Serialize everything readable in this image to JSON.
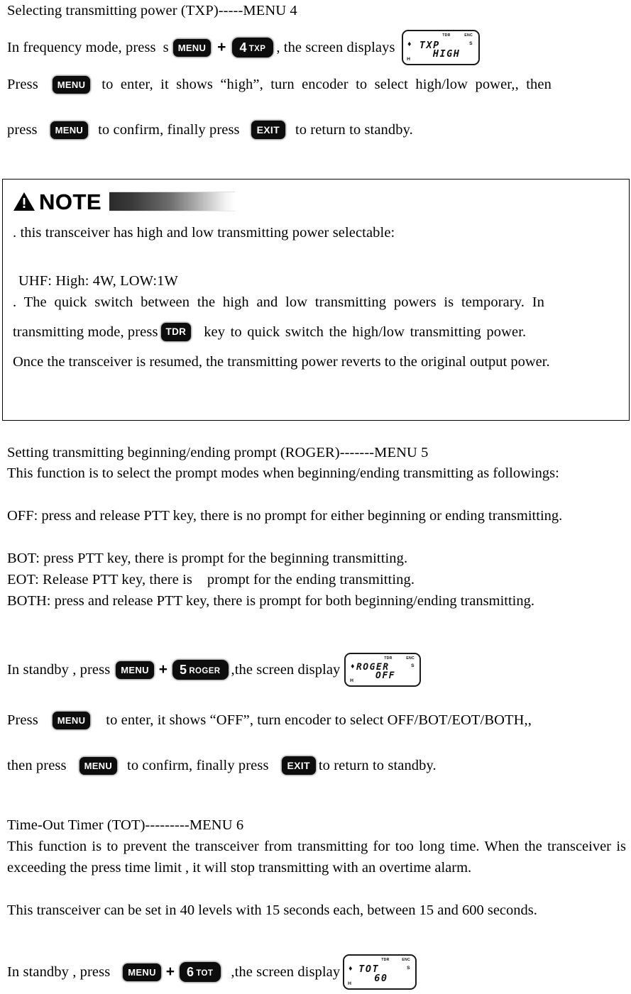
{
  "document": {
    "type": "two-way-radio-user-manual-page"
  },
  "section_txp": {
    "heading": "Selecting transmitting power (TXP)-----MENU 4",
    "line1_a": "In frequency mode, press",
    "line1_stray": "s",
    "line1_b": ", the screen displays",
    "keys": {
      "menu": "MENU",
      "num4_digit": "4",
      "num4_label": "TXP"
    },
    "lcd": {
      "line1": "TXP",
      "line2": "HIGH",
      "tiny_tdr": "TDR",
      "tiny_enc": "ENC",
      "tiny_s": "S",
      "tiny_h": "H",
      "tiny_dot": "♦"
    },
    "line2_a": "Press",
    "line2_b": "to enter, it shows “high”, turn encoder to select high/low power,, then",
    "line3_a": "press",
    "line3_b": "to confirm, finally press",
    "line3_c": "to return to standby.",
    "key_exit": "EXIT"
  },
  "note_box": {
    "title": "NOTE",
    "icon": "warning-triangle-icon",
    "bullet1": ". this transceiver has high and low transmitting power selectable:",
    "spec": "UHF: High: 4W, LOW:1W",
    "bullet2_a": ". The quick switch between the high and low transmitting powers is temporary. In",
    "bullet2_b": "transmitting mode, press",
    "key_tdr": "TDR",
    "bullet2_c": "key to quick switch the high/low transmitting power.",
    "bullet2_d": "Once the transceiver is resumed, the transmitting power reverts to the original output power."
  },
  "section_roger": {
    "heading": "Setting transmitting beginning/ending prompt (ROGER)-------MENU 5",
    "intro": "This function is to select the prompt modes when beginning/ending transmitting as followings:",
    "modes": [
      "OFF: press and release PTT key, there is no prompt for either beginning or ending transmitting.",
      "BOT: press PTT key, there is prompt for the beginning transmitting.",
      "EOT: Release PTT key, there is    prompt for the ending transmitting.",
      "BOTH: press and release PTT key, there is prompt for both beginning/ending transmitting."
    ],
    "line_a": "In standby , press",
    "line_b": ",the screen display",
    "keys": {
      "menu": "MENU",
      "num5_digit": "5",
      "num5_label": "ROGER"
    },
    "lcd": {
      "line1": "ROGER",
      "line2": "OFF",
      "tiny_tdr": "TDR",
      "tiny_enc": "ENC",
      "tiny_s": "S",
      "tiny_h": "H",
      "tiny_dot": "♦"
    },
    "press_a": "Press",
    "press_b": "to enter, it shows “OFF”, turn encoder to select OFF/BOT/EOT/BOTH,,",
    "confirm_a": "then press",
    "confirm_b": "to confirm, finally press",
    "confirm_c": "to return to standby.",
    "key_exit": "EXIT"
  },
  "section_tot": {
    "heading": "Time-Out Timer (TOT)---------MENU 6",
    "para1": "This function is to prevent the transceiver from transmitting for too long time. When the transceiver is exceeding the press time limit , it will stop transmitting with an overtime alarm.",
    "para2": "This transceiver can be set in 40 levels with 15 seconds each, between 15 and 600 seconds.",
    "line_a": "In standby , press",
    "line_b": ",the screen display",
    "keys": {
      "menu": "MENU",
      "num6_digit": "6",
      "num6_label": "TOT"
    },
    "lcd": {
      "line1": "TOT",
      "line2": "60",
      "tiny_tdr": "TDR",
      "tiny_enc": "ENC",
      "tiny_s": "S",
      "tiny_h": "H",
      "tiny_dot": "♦"
    }
  }
}
